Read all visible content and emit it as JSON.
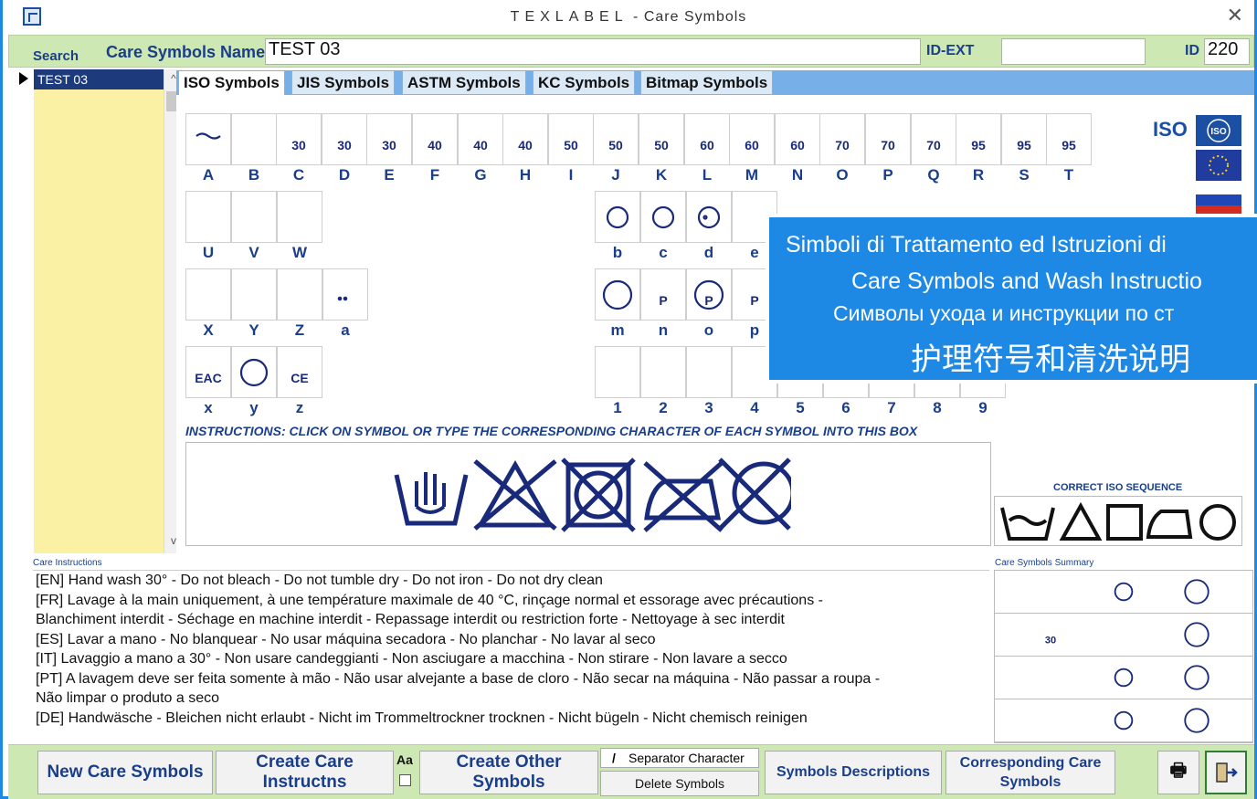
{
  "window": {
    "brand": "TEXLABEL",
    "separator": " - ",
    "title": "Care Symbols",
    "close_glyph": "✕"
  },
  "topbar": {
    "search_label": "Search",
    "name_label": "Care Symbols Name",
    "name_value": "TEST 03",
    "idext_label": "ID-EXT",
    "idext_value": "",
    "id_label": "ID",
    "id_value": "220"
  },
  "list": {
    "items": [
      "TEST 03"
    ]
  },
  "scroll": {
    "up": "^",
    "down": "v"
  },
  "tabs": [
    "ISO Symbols",
    "JIS Symbols",
    "ASTM Symbols",
    "KC Symbols",
    "Bitmap Symbols"
  ],
  "iso": {
    "logo_text": "ISO",
    "badge": "ISO"
  },
  "wash_temps": [
    "",
    "",
    "30",
    "30",
    "30",
    "40",
    "40",
    "40",
    "50",
    "50",
    "50",
    "60",
    "60",
    "60",
    "70",
    "70",
    "70",
    "95",
    "95",
    "95"
  ],
  "codes": {
    "row1": [
      "A",
      "B",
      "C",
      "D",
      "E",
      "F",
      "G",
      "H",
      "I",
      "J",
      "K",
      "L",
      "M",
      "N",
      "O",
      "P",
      "Q",
      "R",
      "S",
      "T"
    ],
    "row2_left": [
      "U",
      "V",
      "W"
    ],
    "row2_right": [
      "b",
      "c",
      "d",
      "e"
    ],
    "row3_left": [
      "X",
      "Y",
      "Z",
      "a"
    ],
    "row3_right": [
      "m",
      "n",
      "o",
      "p"
    ],
    "row4_left": [
      "x",
      "y",
      "z"
    ],
    "row4_right": [
      "1",
      "2",
      "3",
      "4",
      "5",
      "6",
      "7",
      "8",
      "9"
    ]
  },
  "marks": {
    "eac": "EAC",
    "ce": "CE",
    "pro": "P"
  },
  "overlay": {
    "line_it": "Simboli di Trattamento ed Istruzioni di",
    "line_en": "Care Symbols and Wash Instructio",
    "line_ru": "Символы ухода и инструкции по ст",
    "line_zh": "护理符号和清洗说明"
  },
  "instructions_text": "INSTRUCTIONS: CLICK ON SYMBOL OR TYPE THE CORRESPONDING CHARACTER OF EACH SYMBOL INTO THIS BOX",
  "correct_iso_label": "CORRECT ISO SEQUENCE",
  "care_label": "Care Instructions",
  "care_lines": [
    "[EN]  Hand wash 30° - Do not bleach - Do not tumble dry - Do not iron - Do not dry clean",
    "[FR]  Lavage à la main uniquement, à une température maximale de 40 °C, rinçage normal et essorage avec précautions -",
    "Blanchiment interdit - Séchage en machine interdit - Repassage interdit ou restriction forte - Nettoyage à sec interdit",
    "[ES]  Lavar a mano - No blanquear - No usar máquina secadora - No planchar - No lavar al seco",
    "[IT]  Lavaggio a mano a 30° - Non usare candeggianti - Non asciugare a macchina - Non stirare - Non lavare a secco",
    "[PT]  A lavagem deve ser feita somente à mão - Não usar alvejante a base de cloro - Não secar na máquina - Não passar a roupa -",
    "Não limpar o produto a seco",
    "[DE]  Handwäsche - Bleichen nicht erlaubt - Nicht im Trommeltrockner trocknen - Nicht bügeln - Nicht chemisch reinigen"
  ],
  "summary_label": "Care Symbols Summary",
  "summary_temp": "30",
  "buttons": {
    "new": "New Care Symbols",
    "create_instr": "Create Care Instructns",
    "aa": "Aa",
    "create_other": "Create Other Symbols",
    "separator_value": "/",
    "separator_label": "Separator Character",
    "delete": "Delete Symbols",
    "descriptions": "Symbols Descriptions",
    "corresponding_1": "Corresponding Care",
    "corresponding_2": "Symbols",
    "print_glyph": "🖶"
  },
  "colors": {
    "symbol_ink": "#1a2a7a",
    "accent_blue": "#1e88e5",
    "green_bar": "#cde8b2",
    "list_yellow": "#fbf1a4"
  }
}
